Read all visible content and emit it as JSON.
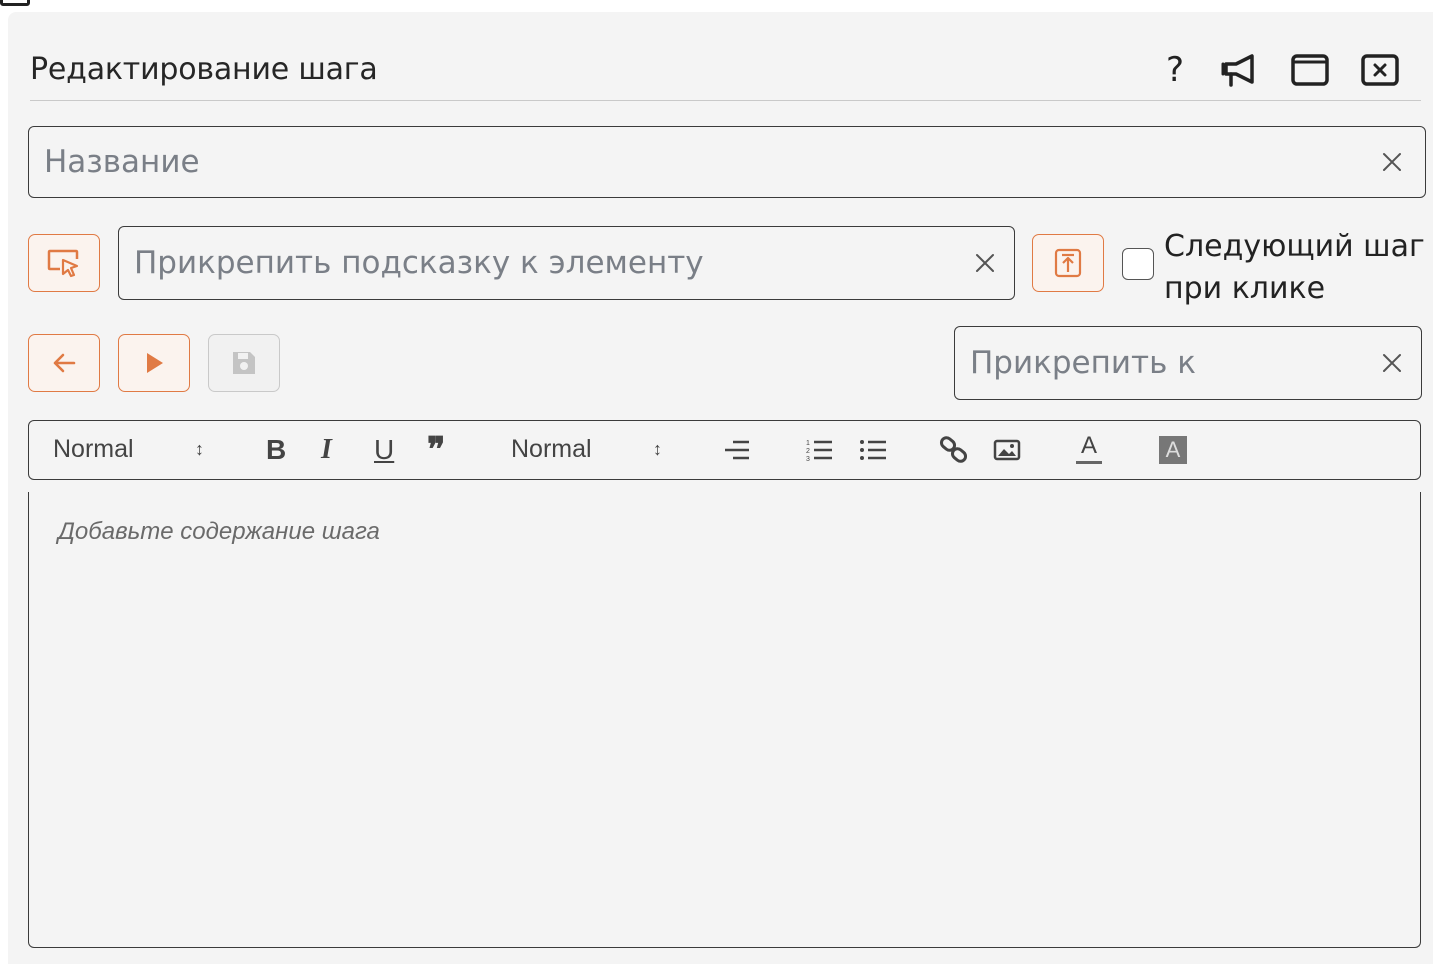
{
  "panel": {
    "title": "Редактирование шага",
    "header_icons": [
      "help-icon",
      "megaphone-icon",
      "maximize-icon",
      "close-window-icon"
    ],
    "help_label": "?"
  },
  "name_field": {
    "placeholder": "Название"
  },
  "element_field": {
    "placeholder": "Прикрепить подсказку к элементу"
  },
  "next_on_click": {
    "label": "Следующий шаг при клике",
    "checked": false
  },
  "attach_field": {
    "placeholder": "Прикрепить к"
  },
  "toolbar": {
    "header_select": "Normal",
    "size_select": "Normal",
    "bold": "B",
    "italic": "I",
    "underline": "U",
    "quote": "❞",
    "color_a": "A",
    "bg_a": "A"
  },
  "editor": {
    "placeholder": "Добавьте содержание шага"
  },
  "colors": {
    "accent": "#e07a44",
    "border": "#3b3b3b",
    "background": "#f4f4f4"
  }
}
